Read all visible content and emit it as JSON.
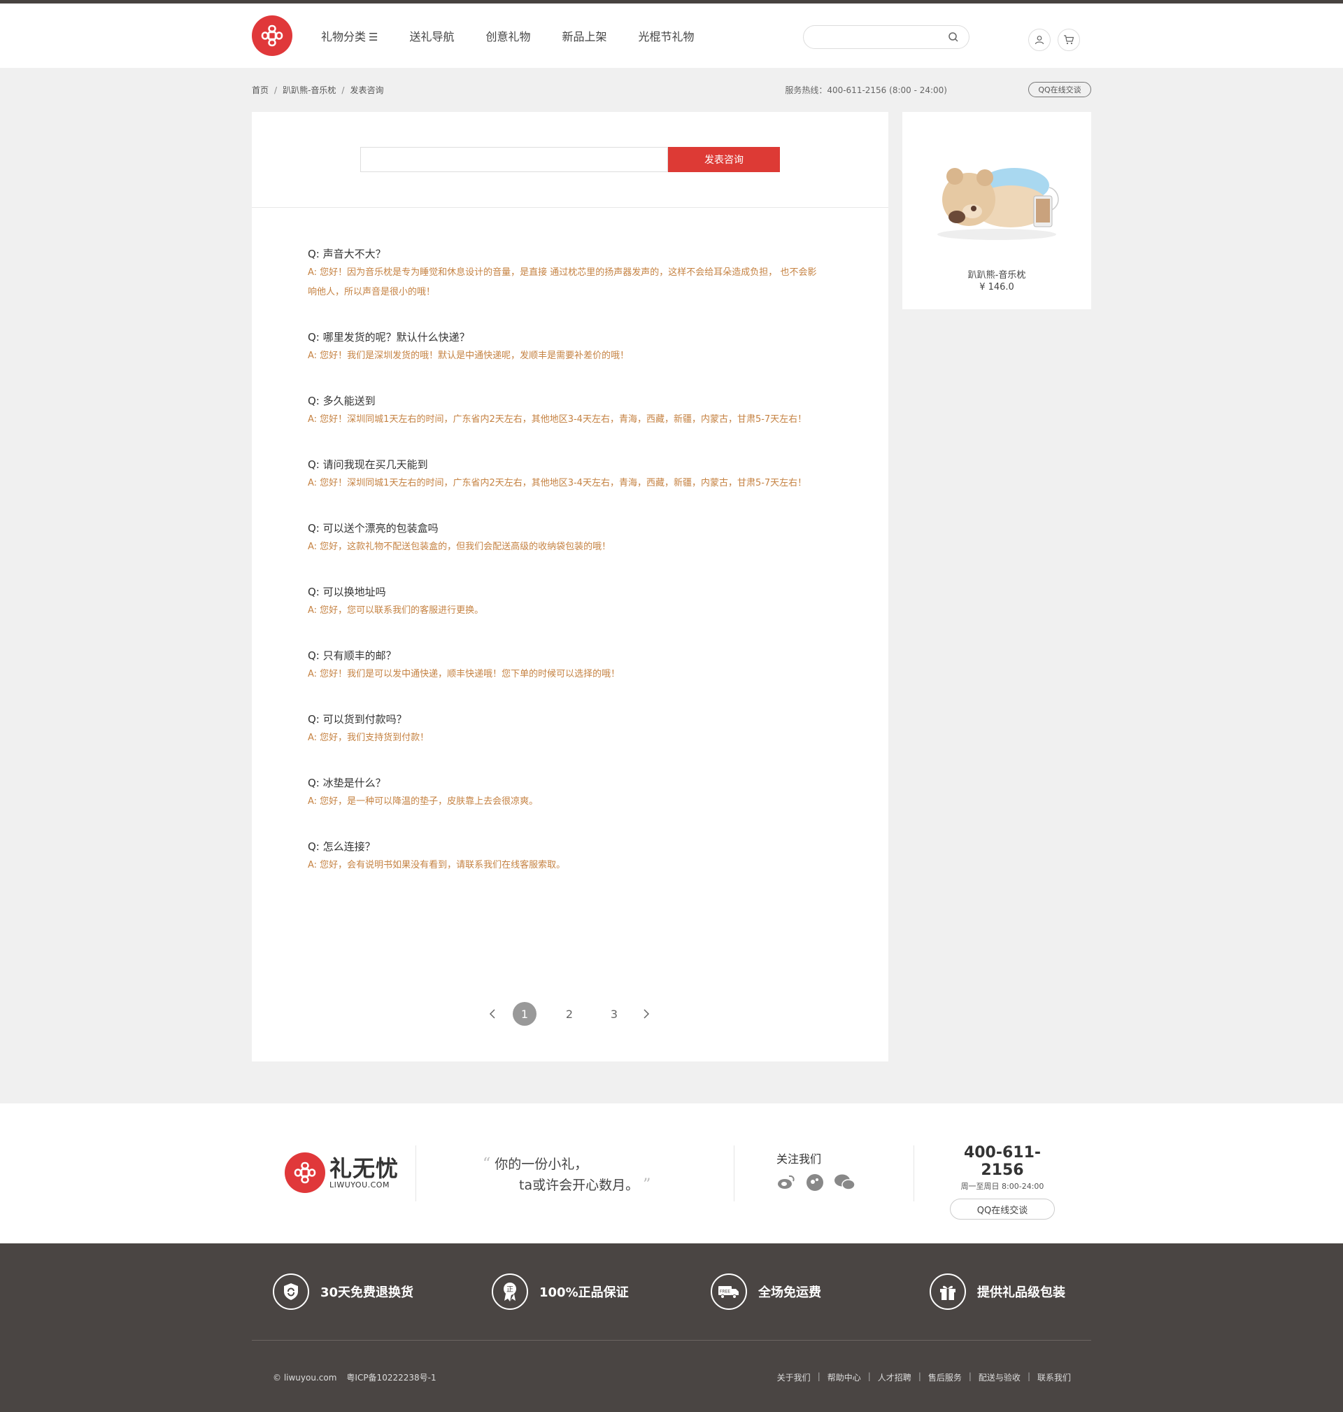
{
  "colors": {
    "accent": "#dd3a35",
    "answer": "#c58242",
    "footer_dark": "#4a4543"
  },
  "nav": [
    {
      "label": "礼物分类",
      "icon": "menu-icon"
    },
    {
      "label": "送礼导航"
    },
    {
      "label": "创意礼物"
    },
    {
      "label": "新品上架"
    },
    {
      "label": "光棍节礼物"
    }
  ],
  "search": {
    "placeholder": ""
  },
  "breadcrumb": [
    "首页",
    "趴趴熊-音乐枕",
    "发表咨询"
  ],
  "hotline": "服务热线：400-611-2156 (8:00 - 24:00)",
  "qq_small": "QQ在线交谈",
  "ask": {
    "placeholder": "",
    "button": "发表咨询"
  },
  "qa": [
    {
      "q": "Q: 声音大不大？",
      "a": "A: 您好！因为音乐枕是专为睡觉和休息设计的音量，是直接 通过枕芯里的扬声器发声的，这样不会给耳朵造成负担， 也不会影响他人，所以声音是很小的哦！"
    },
    {
      "q": "Q: 哪里发货的呢？默认什么快递？",
      "a": "A: 您好！我们是深圳发货的哦！默认是中通快递呢，发顺丰是需要补差价的哦！"
    },
    {
      "q": "Q: 多久能送到",
      "a": "A: 您好！深圳同城1天左右的时间，广东省内2天左右，其他地区3-4天左右，青海，西藏，新疆，内蒙古，甘肃5-7天左右！"
    },
    {
      "q": "Q: 请问我现在买几天能到",
      "a": "A: 您好！深圳同城1天左右的时间，广东省内2天左右，其他地区3-4天左右，青海，西藏，新疆，内蒙古，甘肃5-7天左右！"
    },
    {
      "q": "Q: 可以送个漂亮的包装盒吗",
      "a": "A: 您好，这款礼物不配送包装盒的，但我们会配送高级的收纳袋包装的哦！"
    },
    {
      "q": "Q: 可以换地址吗",
      "a": "A: 您好，您可以联系我们的客服进行更换。"
    },
    {
      "q": "Q: 只有顺丰的邮？",
      "a": "A: 您好！我们是可以发中通快递，顺丰快递哦！您下单的时候可以选择的哦！"
    },
    {
      "q": "Q: 可以货到付款吗？",
      "a": "A: 您好，我们支持货到付款！"
    },
    {
      "q": "Q: 冰垫是什么？",
      "a": "A: 您好，是一种可以降温的垫子，皮肤靠上去会很凉爽。"
    },
    {
      "q": "Q: 怎么连接？",
      "a": "A: 您好，会有说明书如果没有看到，请联系我们在线客服索取。"
    }
  ],
  "pagination": {
    "pages": [
      "1",
      "2",
      "3"
    ],
    "current": "1"
  },
  "product": {
    "name": "趴趴熊-音乐枕",
    "price": "¥ 146.0"
  },
  "footer": {
    "brand_name": "礼无忧",
    "brand_domain": "LIWUYOU.COM",
    "slogan_line1": "你的一份小礼，",
    "slogan_line2": "ta或许会开心数月。",
    "follow_title": "关注我们",
    "social_icons": [
      "weibo-icon",
      "qq-icon",
      "wechat-icon"
    ],
    "phone": "400-611-2156",
    "hours": "周一至周日 8:00-24:00",
    "qq_button": "QQ在线交谈",
    "guarantees": [
      {
        "label": "30天免费退换货",
        "icon": "shield-icon"
      },
      {
        "label": "100%正品保证",
        "icon": "badge-icon"
      },
      {
        "label": "全场免运费",
        "icon": "truck-icon"
      },
      {
        "label": "提供礼品级包装",
        "icon": "gift-icon"
      }
    ],
    "copyright": "© liwuyou.com",
    "icp": "粤ICP备10222238号-1",
    "links": [
      "关于我们",
      "帮助中心",
      "人才招聘",
      "售后服务",
      "配送与验收",
      "联系我们"
    ]
  }
}
